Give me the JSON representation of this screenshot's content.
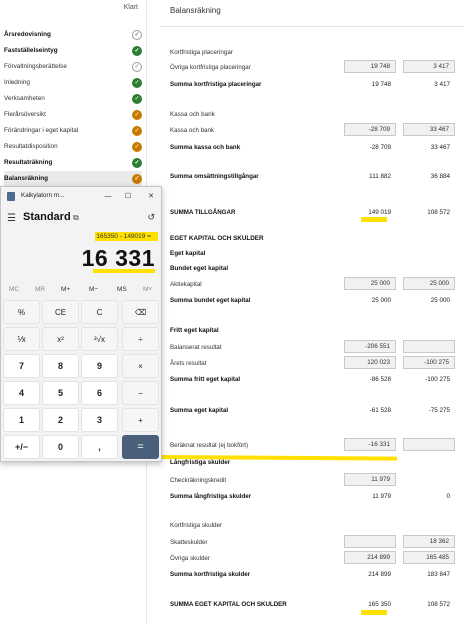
{
  "sidebar": {
    "status_label": "Klart",
    "items": [
      {
        "label": "Årsredovisning",
        "bold": true,
        "status": "open"
      },
      {
        "label": "Fastställelseintyg",
        "bold": true,
        "status": "done"
      },
      {
        "label": "Förvaltningsberättelse",
        "bold": false,
        "status": "open"
      },
      {
        "label": "Inledning",
        "bold": false,
        "status": "done"
      },
      {
        "label": "Verksamheten",
        "bold": false,
        "status": "done"
      },
      {
        "label": "Flerårsöversikt",
        "bold": false,
        "status": "warn"
      },
      {
        "label": "Förändringar i eget kapital",
        "bold": false,
        "status": "warn"
      },
      {
        "label": "Resultatdisposition",
        "bold": false,
        "status": "warn"
      },
      {
        "label": "Resultaträkning",
        "bold": true,
        "status": "done"
      },
      {
        "label": "Balansräkning",
        "bold": true,
        "status": "warn",
        "active": true
      }
    ],
    "status_glyphs": {
      "done": "✓",
      "warn": "✓",
      "open": "✓"
    }
  },
  "report": {
    "title": "Balansräkning",
    "kortfristiga_placeringar": "Kortfristiga placeringar",
    "ovriga_kortfristiga_placeringar": {
      "label": "Övriga kortfristiga placeringar",
      "v1": "19 748",
      "v2": "3 417"
    },
    "summa_kortfristiga_placeringar": {
      "label": "Summa kortfristiga placeringar",
      "v1": "19 748",
      "v2": "3 417"
    },
    "kassa_och_bank_heading": "Kassa och bank",
    "kassa_och_bank": {
      "label": "Kassa och bank",
      "v1": "-28 709",
      "v2": "33 467"
    },
    "summa_kassa_och_bank": {
      "label": "Summa kassa och bank",
      "v1": "-28 709",
      "v2": "33 467"
    },
    "summa_omsattningstillgangar": {
      "label": "Summa omsättningstillgångar",
      "v1": "111 882",
      "v2": "36 884"
    },
    "summa_tillgangar": {
      "label": "SUMMA TILLGÅNGAR",
      "v1": "149 019",
      "v2": "108 572"
    },
    "eget_kapital_och_skulder": "EGET KAPITAL OCH SKULDER",
    "eget_kapital": "Eget kapital",
    "bundet_eget_kapital": "Bundet eget kapital",
    "aktiekapital": {
      "label": "Aktiekapital",
      "v1": "25 000",
      "v2": "25 000"
    },
    "summa_bundet_eget_kapital": {
      "label": "Summa bundet eget kapital",
      "v1": "25 000",
      "v2": "25 000"
    },
    "fritt_eget_kapital": "Fritt eget kapital",
    "balanserat_resultat": {
      "label": "Balanserat resultat",
      "v1": "-206 551",
      "v2": ""
    },
    "arets_resultat": {
      "label": "Årets resultat",
      "v1": "120 023",
      "v2": "-100 275"
    },
    "summa_fritt_eget_kapital": {
      "label": "Summa fritt eget kapital",
      "v1": "-86 528",
      "v2": "-100 275"
    },
    "summa_eget_kapital": {
      "label": "Summa eget kapital",
      "v1": "-61 528",
      "v2": "-75 275"
    },
    "beraknat_resultat": {
      "label": "Beräknat resultat (ej bokfört)",
      "v1": "-16 331",
      "v2": ""
    },
    "langfristiga_skulder": "Långfristiga skulder",
    "checkrakningskredit": {
      "label": "Checkräkningskredit",
      "v1": "11 979",
      "v2": ""
    },
    "summa_langfristiga_skulder": {
      "label": "Summa långfristiga skulder",
      "v1": "11 979",
      "v2": "0"
    },
    "kortfristiga_skulder": "Kortfristiga skulder",
    "skatteskulder": {
      "label": "Skatteskulder",
      "v1": "",
      "v2": "18 362"
    },
    "ovriga_skulder": {
      "label": "Övriga skulder",
      "v1": "214 899",
      "v2": "165 485"
    },
    "summa_kortfristiga_skulder": {
      "label": "Summa kortfristiga skulder",
      "v1": "214 899",
      "v2": "183 847"
    },
    "summa_eget_kapital_och_skulder": {
      "label": "SUMMA EGET KAPITAL OCH SKULDER",
      "v1": "165 350",
      "v2": "108 572"
    }
  },
  "calculator": {
    "title": "Kalkylatorn m...",
    "mode": "Standard",
    "expression": "165350 - 149019 =",
    "result": "16 331",
    "memory": [
      "MC",
      "MR",
      "M+",
      "M−",
      "MS",
      "M˅"
    ],
    "keys": [
      "%",
      "CE",
      "C",
      "⌫",
      "⅟x",
      "x²",
      "²√x",
      "÷",
      "7",
      "8",
      "9",
      "×",
      "4",
      "5",
      "6",
      "−",
      "1",
      "2",
      "3",
      "+",
      "+/−",
      "0",
      ",",
      "="
    ],
    "window_buttons": {
      "minimize": "—",
      "maximize": "☐",
      "close": "✕"
    },
    "icons": {
      "menu": "☰",
      "keep_on_top": "⧉",
      "history": "↺"
    }
  }
}
